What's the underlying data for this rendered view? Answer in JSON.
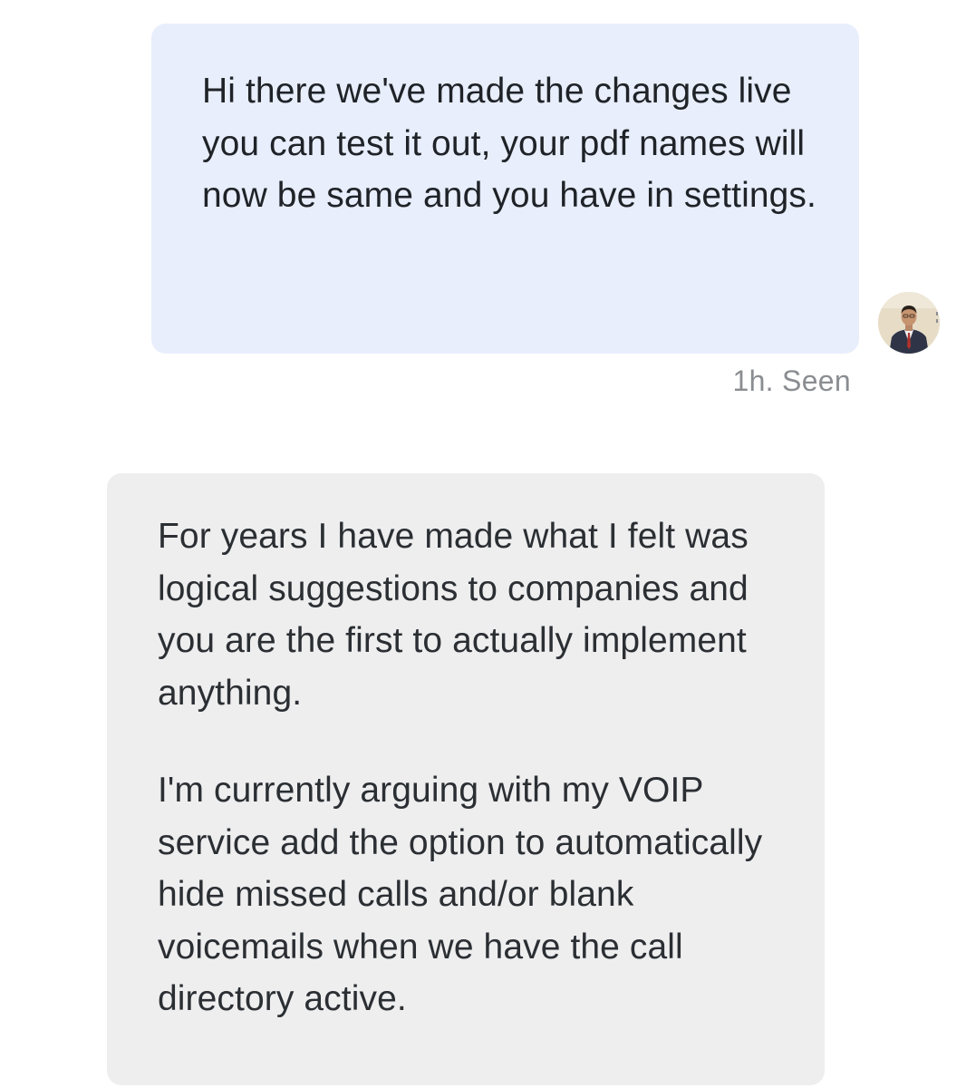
{
  "messages": [
    {
      "direction": "outgoing",
      "paragraphs": [
        "Hi there we've made the changes live you can test it out, your pdf names will now be same and you have in settings."
      ],
      "time": "1h",
      "status": "Seen",
      "meta_text": "1h. Seen",
      "avatar": "agent-avatar"
    },
    {
      "direction": "incoming",
      "paragraphs": [
        "For years I have made what I felt was logical suggestions to companies and you are the first to actually implement anything.",
        "I'm currently arguing with my VOIP service add the option to automatically hide missed calls and/or blank voicemails when we have the call directory active."
      ]
    }
  ],
  "colors": {
    "outgoing_bubble": "#e8eefb",
    "incoming_bubble": "#eeeeef",
    "meta_text": "#8a8d91"
  }
}
